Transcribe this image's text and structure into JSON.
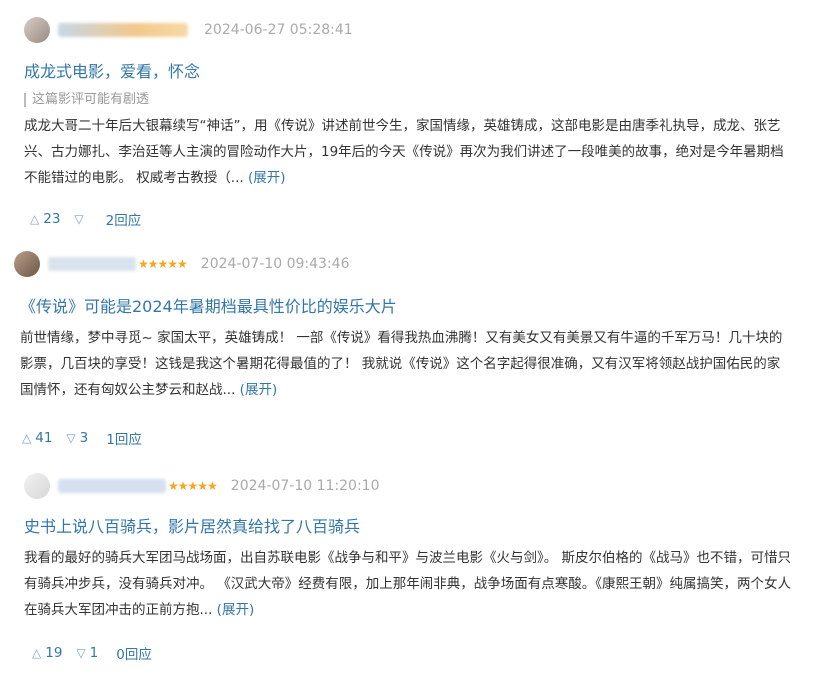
{
  "reviews": [
    {
      "time": "2024-06-27 05:28:41",
      "stars": "",
      "title": "成龙式电影，爱看，怀念",
      "spoiler": "这篇影评可能有剧透",
      "body": "成龙大哥二十年后大银幕续写“神话”，用《传说》讲述前世今生，家国情缘，英雄铸成，这部电影是由唐季礼执导，成龙、张艺兴、古力娜扎、李治廷等人主演的冒险动作大片，19年后的今天《传说》再次为我们讲述了一段唯美的故事，绝对是今年暑期档不能错过的电影。 权威考古教授（...",
      "expand": "(展开)",
      "up": "23",
      "down": "",
      "replies": "2回应"
    },
    {
      "time": "2024-07-10 09:43:46",
      "stars": "★★★★★",
      "title": "《传说》可能是2024年暑期档最具性价比的娱乐大片",
      "spoiler": "",
      "body": "前世情缘，梦中寻觅~ 家国太平，英雄铸成！ 一部《传说》看得我热血沸腾！又有美女又有美景又有牛逼的千军万马！几十块的影票，几百块的享受！这钱是我这个暑期花得最值的了！ 我就说《传说》这个名字起得很准确，又有汉军将领赵战护国佑民的家国情怀，还有匈奴公主梦云和赵战...",
      "expand": "(展开)",
      "up": "41",
      "down": "3",
      "replies": "1回应"
    },
    {
      "time": "2024-07-10 11:20:10",
      "stars": "★★★★★",
      "title": "史书上说八百骑兵，影片居然真给找了八百骑兵",
      "spoiler": "",
      "body": "我看的最好的骑兵大军团马战场面，出自苏联电影《战争与和平》与波兰电影《火与剑》。 斯皮尔伯格的《战马》也不错，可惜只有骑兵冲步兵，没有骑兵对冲。 《汉武大帝》经费有限，加上那年闹非典，战争场面有点寒酸。《康熙王朝》纯属搞笑，两个女人在骑兵大军团冲击的正前方抱...",
      "expand": "(展开)",
      "up": "19",
      "down": "1",
      "replies": "0回应"
    }
  ],
  "icons": {
    "up": "triangle-up-icon",
    "down": "triangle-down-icon"
  },
  "colors": {
    "link": "#3377aa",
    "star": "#f5a623",
    "meta": "#aaaaaa",
    "text": "#333333"
  }
}
